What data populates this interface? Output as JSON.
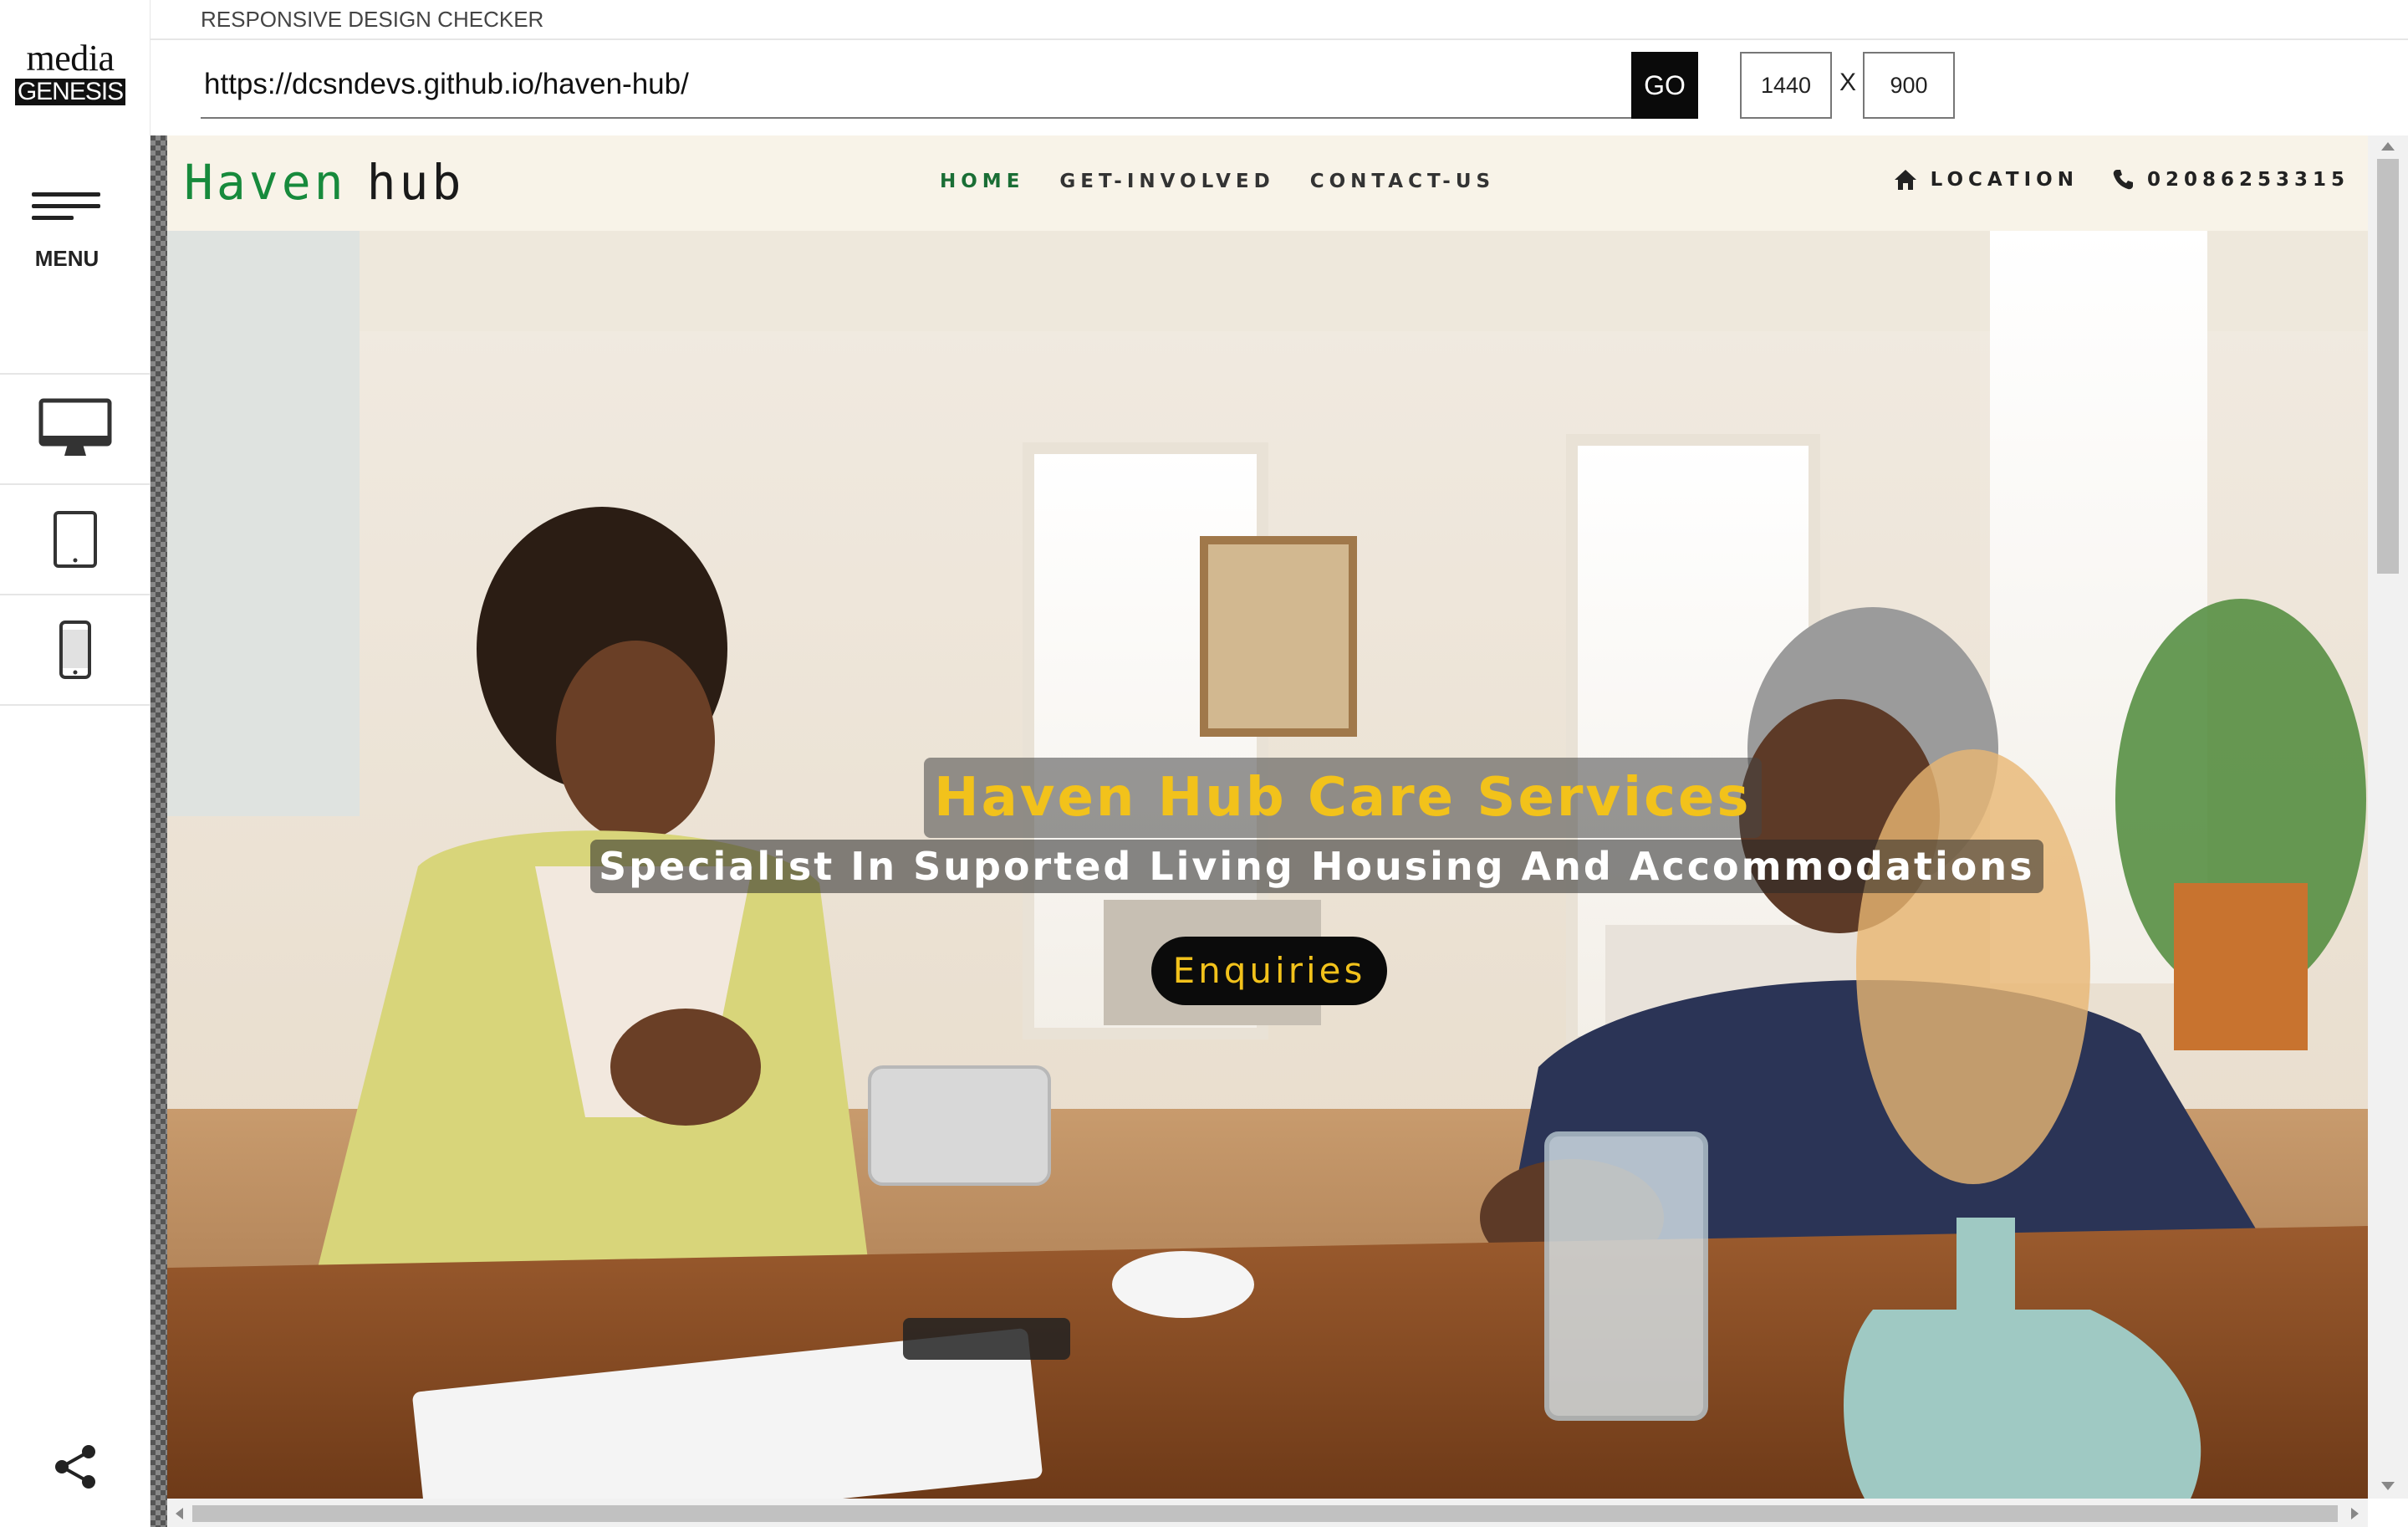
{
  "app": {
    "title": "RESPONSIVE DESIGN CHECKER",
    "logo_top": "media",
    "logo_bottom": "GENESIS",
    "menu_label": "MENU"
  },
  "toolbar": {
    "url": "https://dcsndevs.github.io/haven-hub/",
    "go_label": "GO",
    "width": "1440",
    "height": "900",
    "x_separator": "X"
  },
  "devices": [
    {
      "name": "desktop-icon"
    },
    {
      "name": "tablet-icon"
    },
    {
      "name": "mobile-icon"
    }
  ],
  "site": {
    "brand_a": "Haven",
    "brand_b": "hub",
    "nav": [
      "HOME",
      "GET-INVOLVED",
      "CONTACT-US"
    ],
    "location_label": "LOCATION",
    "phone": "02086253315",
    "hero_title": "Haven Hub Care Services",
    "hero_subtitle": "Specialist In Suported Living Housing And Accommodations",
    "hero_button": "Enquiries"
  },
  "colors": {
    "brand_green": "#178a3c",
    "nav_bg": "#f8f3e8",
    "hero_accent": "#f2c21b",
    "go_button": "#0a0a0a"
  }
}
